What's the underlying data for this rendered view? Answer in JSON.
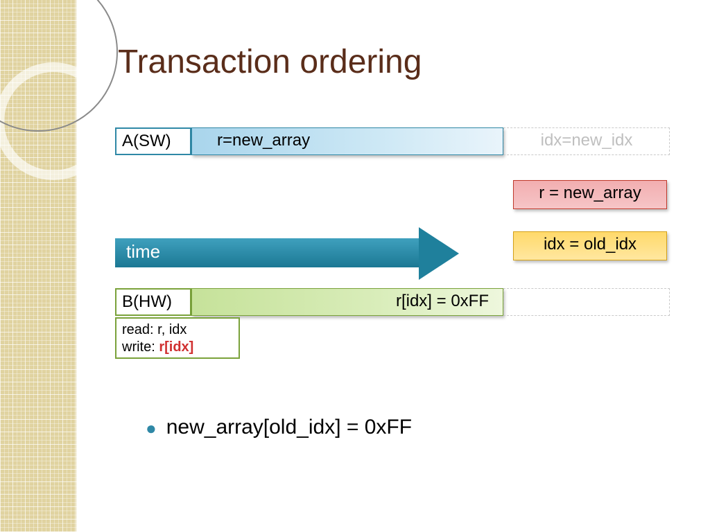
{
  "title": "Transaction ordering",
  "rowA": {
    "label": "A(SW)",
    "bar": "r=new_array",
    "ghost": "idx=new_idx"
  },
  "red_box": "r = new_array",
  "yellow_box": "idx = old_idx",
  "time_label": "time",
  "rowB": {
    "label": "B(HW)",
    "bar": "r[idx] = 0xFF",
    "note_read": "read: r, idx",
    "note_write_prefix": "write: ",
    "note_write_hl": "r[idx]"
  },
  "bullet": "new_array[old_idx] = 0xFF"
}
